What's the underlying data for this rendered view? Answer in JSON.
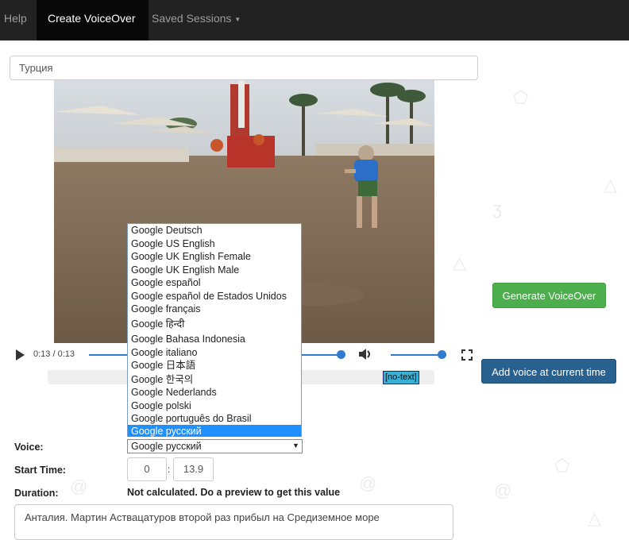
{
  "navbar": {
    "items": [
      {
        "label": "Help",
        "active": false
      },
      {
        "label": "Create VoiceOver",
        "active": true
      },
      {
        "label": "Saved Sessions",
        "active": false,
        "caret": "caret-down-icon"
      }
    ]
  },
  "title_input": {
    "value": "Турция"
  },
  "player": {
    "time": "0:13 / 0:13",
    "progress": 1.0,
    "volume": 1.0,
    "timeline_marker": "[no-text]"
  },
  "voice_list": {
    "options": [
      "Google Deutsch",
      "Google US English",
      "Google UK English Female",
      "Google UK English Male",
      "Google español",
      "Google español de Estados Unidos",
      "Google français",
      "Google हिन्दी",
      "Google Bahasa Indonesia",
      "Google italiano",
      "Google 日本語",
      "Google 한국의",
      "Google Nederlands",
      "Google polski",
      "Google português do Brasil",
      "Google русский"
    ],
    "selected": "Google русский"
  },
  "buttons": {
    "generate": "Generate VoiceOver",
    "add_voice": "Add voice at current time"
  },
  "form": {
    "voice_label": "Voice:",
    "start_label": "Start Time:",
    "duration_label": "Duration:",
    "start_minutes": "0",
    "start_colon": ":",
    "start_seconds": "13.9",
    "duration_value": "Not calculated. Do a preview to get this value",
    "text": "Анталия. Мартин Аствацатуров второй раз прибыл на Средиземное море"
  },
  "colors": {
    "navbar": "#222222",
    "accent_blue": "#286090",
    "success_green": "#4cae4c",
    "selection_blue": "#1e90ff"
  }
}
